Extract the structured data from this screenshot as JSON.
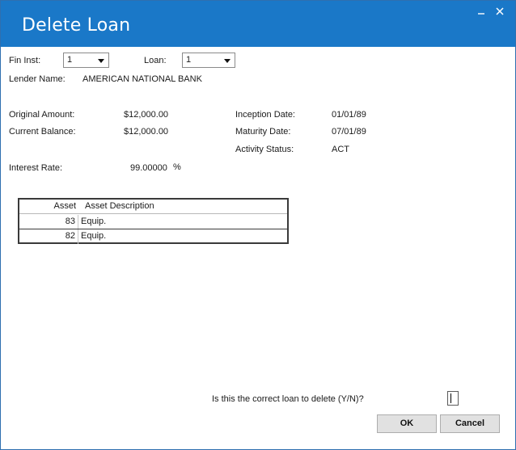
{
  "window": {
    "title": "Delete Loan",
    "minimize_glyph": "_",
    "close_glyph": "✕"
  },
  "form": {
    "fin_inst_label": "Fin Inst:",
    "fin_inst_value": "1",
    "loan_label": "Loan:",
    "loan_value": "1",
    "lender_name_label": "Lender Name:",
    "lender_name_value": "AMERICAN NATIONAL BANK",
    "original_amount_label": "Original Amount:",
    "original_amount_value": "$12,000.00",
    "current_balance_label": "Current Balance:",
    "current_balance_value": "$12,000.00",
    "interest_rate_label": "Interest Rate:",
    "interest_rate_value": "99.00000",
    "interest_rate_unit": "%",
    "inception_date_label": "Inception Date:",
    "inception_date_value": "01/01/89",
    "maturity_date_label": "Maturity Date:",
    "maturity_date_value": "07/01/89",
    "activity_status_label": "Activity Status:",
    "activity_status_value": "ACT"
  },
  "assets_table": {
    "columns": [
      "Asset",
      "Asset Description"
    ],
    "rows": [
      {
        "asset": "83",
        "description": "Equip."
      },
      {
        "asset": "82",
        "description": "Equip."
      }
    ]
  },
  "confirm": {
    "question": "Is this the correct loan to delete (Y/N)?",
    "answer_value": ""
  },
  "buttons": {
    "ok": "OK",
    "cancel": "Cancel"
  },
  "icons": {
    "dropdown": "chevron-down-icon",
    "minimize": "minimize-icon",
    "close": "close-icon"
  },
  "colors": {
    "titlebar": "#1a78c8",
    "title_text": "#ffffff"
  }
}
